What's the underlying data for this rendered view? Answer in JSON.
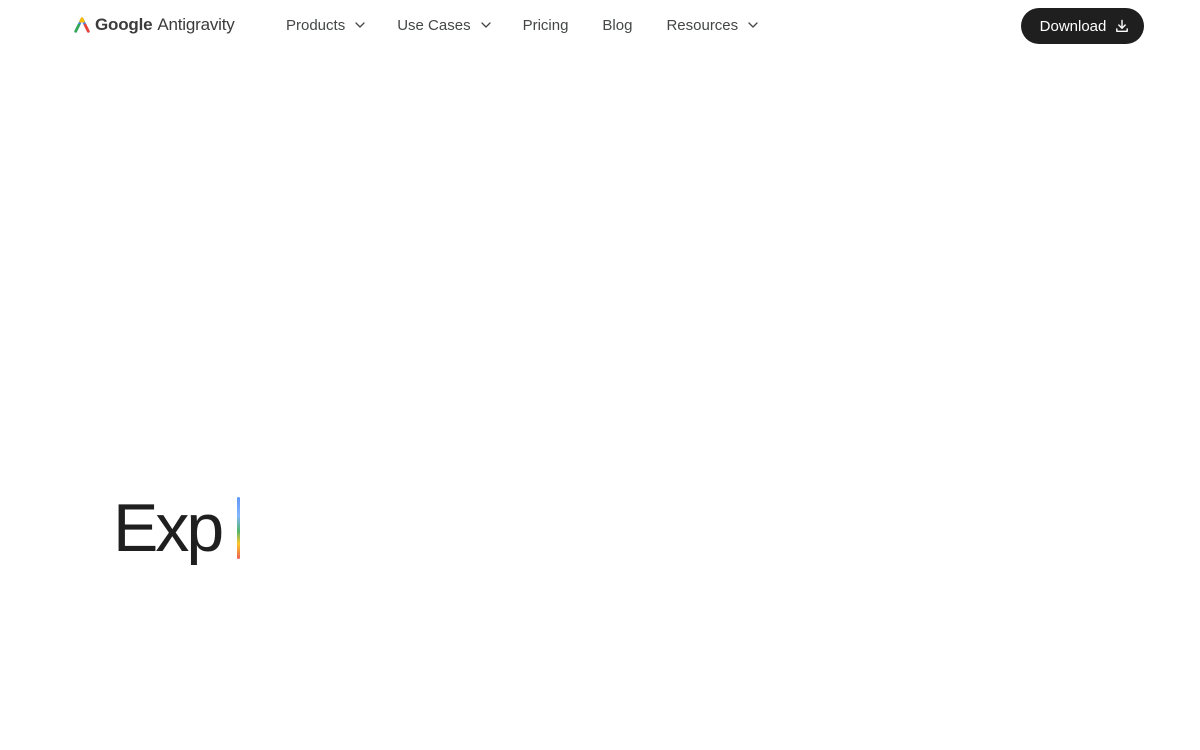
{
  "brand": {
    "google": "Google",
    "product": "Antigravity",
    "mark_icon": "antigravity-logo-icon",
    "colors": {
      "blue": "#4285f4",
      "red": "#ea4335",
      "yellow": "#fbbc04",
      "green": "#34a853"
    }
  },
  "nav": {
    "products": "Products",
    "use_cases": "Use Cases",
    "pricing": "Pricing",
    "blog": "Blog",
    "resources": "Resources",
    "dropdown_icon": "chevron-down-icon"
  },
  "download": {
    "label": "Download",
    "icon": "download-icon",
    "background": "#1f1f1f"
  },
  "hero": {
    "typed_text": "Exp",
    "caret_icon": "typing-caret"
  }
}
